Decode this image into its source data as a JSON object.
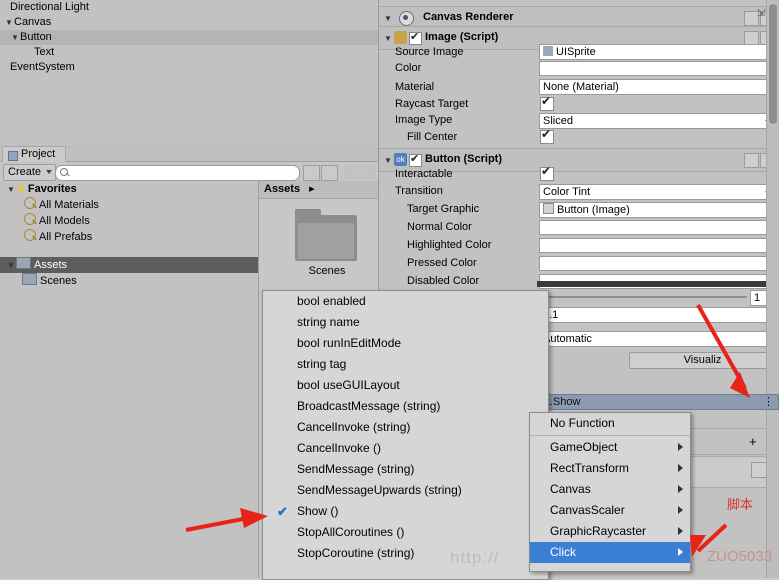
{
  "hierarchy": {
    "items": [
      {
        "label": "Directional Light",
        "indent": 1,
        "tri": "",
        "selected": false
      },
      {
        "label": "Canvas",
        "indent": 0,
        "tri": "▼",
        "selected": false
      },
      {
        "label": "Button",
        "indent": 1,
        "tri": "▼",
        "selected": true
      },
      {
        "label": "Text",
        "indent": 2,
        "tri": "",
        "selected": false
      },
      {
        "label": "EventSystem",
        "indent": 0,
        "tri": "",
        "selected": false
      }
    ]
  },
  "project": {
    "tab_label": "Project",
    "create_label": "Create",
    "search_placeholder": "",
    "left_items": [
      {
        "label": "Favorites",
        "icon": "star",
        "bold": true
      },
      {
        "label": "All Materials",
        "icon": "search",
        "bold": false
      },
      {
        "label": "All Models",
        "icon": "search",
        "bold": false
      },
      {
        "label": "All Prefabs",
        "icon": "search",
        "bold": false
      },
      {
        "label": "Assets",
        "icon": "folder",
        "bold": true,
        "selected": true
      },
      {
        "label": "Scenes",
        "icon": "folder",
        "bold": false
      }
    ],
    "assets_header": "Assets",
    "assets_breadcrumb_arrow": "▸",
    "folder_name": "Scenes"
  },
  "inspector": {
    "canvas_renderer": {
      "title": "Canvas Renderer",
      "arrow": "▼"
    },
    "image_script": {
      "title": "Image (Script)",
      "arrow": "▼",
      "rows": [
        {
          "label": "Source Image",
          "type": "object",
          "value": "UISprite"
        },
        {
          "label": "Color",
          "type": "color",
          "value": "#ffffff"
        },
        {
          "label": "Material",
          "type": "object",
          "value": "None (Material)"
        },
        {
          "label": "Raycast Target",
          "type": "check",
          "value": true
        },
        {
          "label": "Image Type",
          "type": "dropdown",
          "value": "Sliced"
        },
        {
          "label": "Fill Center",
          "type": "check",
          "value": true
        }
      ]
    },
    "button_script": {
      "title": "Button (Script)",
      "arrow": "▼",
      "rows": [
        {
          "label": "Interactable",
          "type": "check",
          "value": true
        },
        {
          "label": "Transition",
          "type": "dropdown",
          "value": "Color Tint"
        },
        {
          "label": "Target Graphic",
          "type": "object",
          "value": "Button (Image)"
        },
        {
          "label": "Normal Color",
          "type": "color",
          "value": "#ffffff"
        },
        {
          "label": "Highlighted Color",
          "type": "color",
          "value": "#ffffff"
        },
        {
          "label": "Pressed Color",
          "type": "color",
          "value": "#ffffff"
        },
        {
          "label": "Disabled Color",
          "type": "color",
          "value": "#ffffff"
        }
      ],
      "color_multiplier_value": "1",
      "fade_duration_value": "0.1",
      "navigation_value": "Automatic",
      "visualize_label": "Visualiz"
    }
  },
  "method_menu": {
    "items": [
      {
        "label": "bool enabled",
        "checked": false
      },
      {
        "label": "string name",
        "checked": false
      },
      {
        "label": "bool runInEditMode",
        "checked": false
      },
      {
        "label": "string tag",
        "checked": false
      },
      {
        "label": "bool useGUILayout",
        "checked": false
      },
      {
        "label": "BroadcastMessage (string)",
        "checked": false
      },
      {
        "label": "CancelInvoke (string)",
        "checked": false
      },
      {
        "label": "CancelInvoke ()",
        "checked": false
      },
      {
        "label": "SendMessage (string)",
        "checked": false
      },
      {
        "label": "SendMessageUpwards (string)",
        "checked": false
      },
      {
        "label": "Show ()",
        "checked": true
      },
      {
        "label": "StopAllCoroutines ()",
        "checked": false
      },
      {
        "label": "StopCoroutine (string)",
        "checked": false
      }
    ]
  },
  "event_panel": {
    "header": "Click.Show"
  },
  "submenu": {
    "items": [
      {
        "label": "No Function",
        "submenu": false,
        "highlight": false
      },
      {
        "label": "GameObject",
        "submenu": true,
        "highlight": false
      },
      {
        "label": "RectTransform",
        "submenu": true,
        "highlight": false
      },
      {
        "label": "Canvas",
        "submenu": true,
        "highlight": false
      },
      {
        "label": "CanvasScaler",
        "submenu": true,
        "highlight": false
      },
      {
        "label": "GraphicRaycaster",
        "submenu": true,
        "highlight": false
      },
      {
        "label": "Click",
        "submenu": true,
        "highlight": true
      }
    ]
  },
  "annotations": {
    "script_label": "脚本",
    "watermark": "http://",
    "watermark_right": "ZUO5033"
  }
}
